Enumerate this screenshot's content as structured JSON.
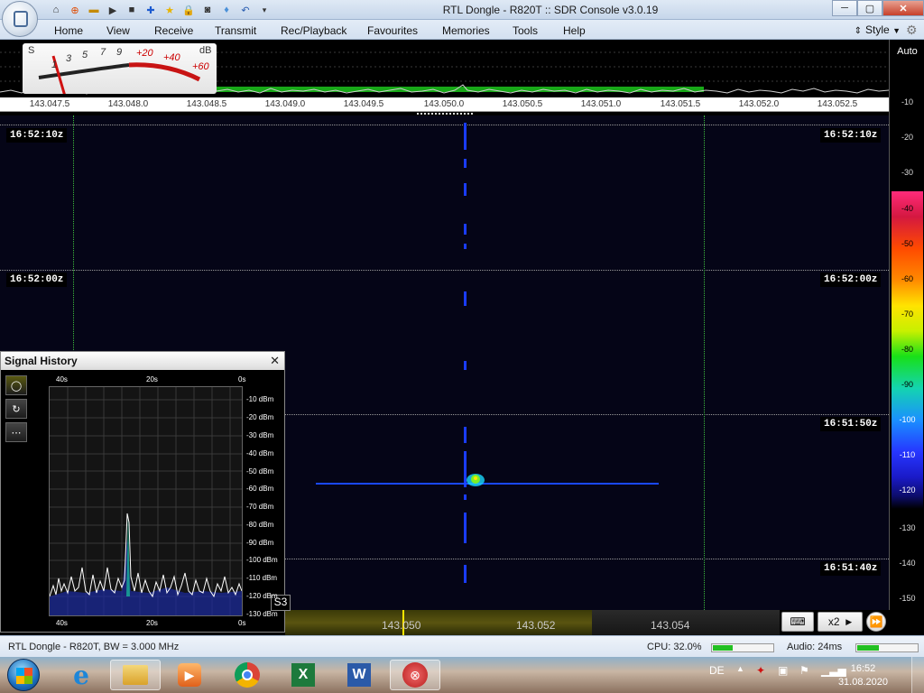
{
  "window": {
    "title": "RTL Dongle - R820T :: SDR Console v3.0.19",
    "controls": [
      "─",
      "▢",
      "✕"
    ]
  },
  "menu": {
    "items": [
      "Home",
      "View",
      "Receive",
      "Transmit",
      "Rec/Playback",
      "Favourites",
      "Memories",
      "Tools",
      "Help"
    ],
    "style_label": "Style"
  },
  "smeter": {
    "s_label": "S",
    "db_label": "dB",
    "s_ticks": [
      "1",
      "3",
      "5",
      "7",
      "9"
    ],
    "db_ticks": [
      "+20",
      "+40",
      "+60"
    ]
  },
  "frequency_scale": [
    "143.047.5",
    "143.048.0",
    "143.048.5",
    "143.049.0",
    "143.049.5",
    "143.050.0",
    "143.050.5",
    "143.051.0",
    "143.051.5",
    "143.052.0",
    "143.052.5"
  ],
  "right_scale": {
    "auto_label": "Auto",
    "ticks": [
      "-10",
      "-20",
      "-30",
      "-40",
      "-50",
      "-60",
      "-70",
      "-80",
      "-90",
      "-100",
      "-110",
      "-120",
      "-130",
      "-140",
      "-150"
    ]
  },
  "waterfall": {
    "time_labels": [
      "16:52:10z",
      "16:52:00z",
      "16:51:50z",
      "16:51:40z"
    ]
  },
  "signal_history": {
    "title": "Signal History",
    "top_time_labels": [
      "40s",
      "20s",
      "0s"
    ],
    "bottom_time_labels": [
      "40s",
      "20s",
      "0s"
    ],
    "db_labels": [
      "-10 dBm",
      "-20 dBm",
      "-30 dBm",
      "-40 dBm",
      "-50 dBm",
      "-60 dBm",
      "-70 dBm",
      "-80 dBm",
      "-90 dBm",
      "-100 dBm",
      "-110 dBm",
      "-120 dBm",
      "-130 dBm"
    ],
    "s_reading": "S3"
  },
  "bottom_strip": {
    "freqs": [
      "143.050",
      "143.052",
      "143.054"
    ],
    "zoom": "x2"
  },
  "status": {
    "device": "RTL Dongle - R820T, BW = 3.000 MHz",
    "cpu": "CPU: 32.0%",
    "audio": "Audio: 24ms",
    "cpu_level": 0.32,
    "audio_level": 0.35
  },
  "taskbar": {
    "language": "DE",
    "time": "16:52",
    "date": "31.08.2020"
  },
  "colors": {
    "accent": "#18a818",
    "signal": "#2a4cff"
  }
}
